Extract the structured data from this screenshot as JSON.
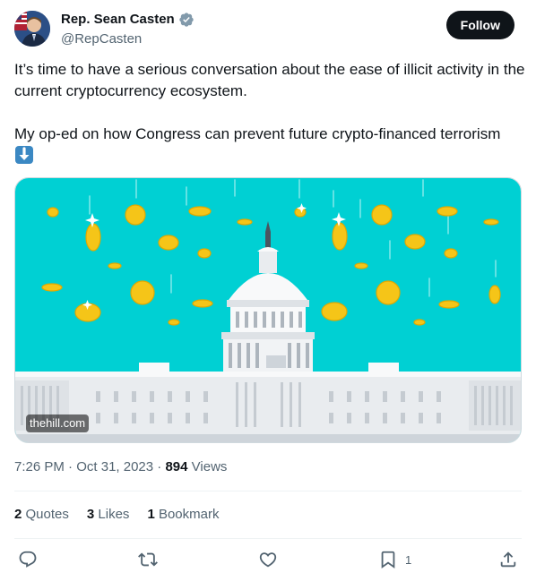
{
  "author": {
    "name": "Rep. Sean Casten",
    "handle": "@RepCasten",
    "follow_label": "Follow"
  },
  "tweet": {
    "text": "It’s time to have a serious conversation about the ease of illicit activity in the current cryptocurrency ecosystem.\n\nMy op-ed on how Congress can prevent future crypto-financed terrorism",
    "emoji": "down-arrow-emoji"
  },
  "media": {
    "domain": "thehill.com",
    "alt_subject": "capitol-dome-with-falling-coins",
    "colors": {
      "sky": "#00d0d3",
      "coin": "#f5c518",
      "building": "#e9ecef"
    }
  },
  "meta": {
    "time": "7:26 PM",
    "date": "Oct 31, 2023",
    "views_count": "894",
    "views_label": "Views"
  },
  "stats": {
    "quotes_count": "2",
    "quotes_label": "Quotes",
    "likes_count": "3",
    "likes_label": "Likes",
    "bookmarks_count": "1",
    "bookmarks_label": "Bookmark"
  },
  "actions": {
    "reply_icon": "reply-icon",
    "retweet_icon": "retweet-icon",
    "like_icon": "heart-icon",
    "bookmark_icon": "bookmark-icon",
    "bookmark_count": "1",
    "share_icon": "share-icon"
  }
}
